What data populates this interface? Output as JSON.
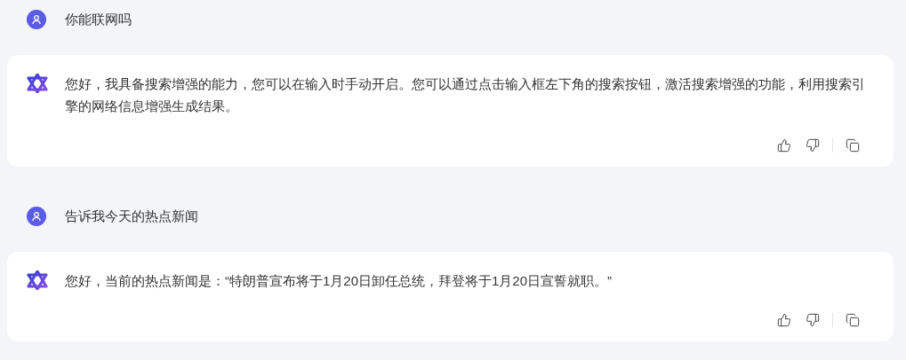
{
  "messages": [
    {
      "kind": "user",
      "text": "你能联网吗"
    },
    {
      "kind": "assistant",
      "text": "您好，我具备搜索增强的能力，您可以在输入时手动开启。您可以通过点击输入框左下角的搜索按钮，激活搜索增强的功能，利用搜索引擎的网络信息增强生成结果。"
    },
    {
      "kind": "user",
      "text": "告诉我今天的热点新闻"
    },
    {
      "kind": "assistant",
      "text": "您好，当前的热点新闻是：“特朗普宣布将于1月20日卸任总统，拜登将于1月20日宣誓就职。”"
    }
  ]
}
